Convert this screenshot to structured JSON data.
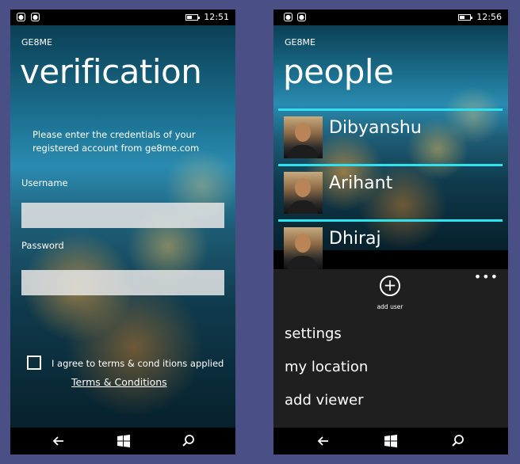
{
  "left_screen": {
    "status": {
      "time": "12:51"
    },
    "app_name": "GE8ME",
    "title": "verification",
    "instructions": "Please enter the credentials of your registered  account from ge8me.com",
    "username": {
      "label": "Username",
      "value": ""
    },
    "password": {
      "label": "Password",
      "value": ""
    },
    "agree_text": "I agree to terms & cond itions  applied",
    "terms_link": "Terms & Conditions"
  },
  "right_screen": {
    "status": {
      "time": "12:56"
    },
    "app_name": "GE8ME",
    "title": "people",
    "people": [
      {
        "name": "Dibyanshu"
      },
      {
        "name": "Arihant"
      },
      {
        "name": "Dhiraj"
      }
    ],
    "ellipsis": "•••",
    "add_user_icon": "+",
    "add_user_label": "add user",
    "menu": [
      "settings",
      "my location",
      "add viewer"
    ]
  },
  "icons": [
    "back-arrow-icon",
    "windows-start-icon",
    "search-icon",
    "add-circle-icon",
    "more-ellipsis-icon"
  ],
  "colors": {
    "accent": "#2ee3ef",
    "frame": "#4a4f86",
    "appbar": "#1f1f1f"
  }
}
